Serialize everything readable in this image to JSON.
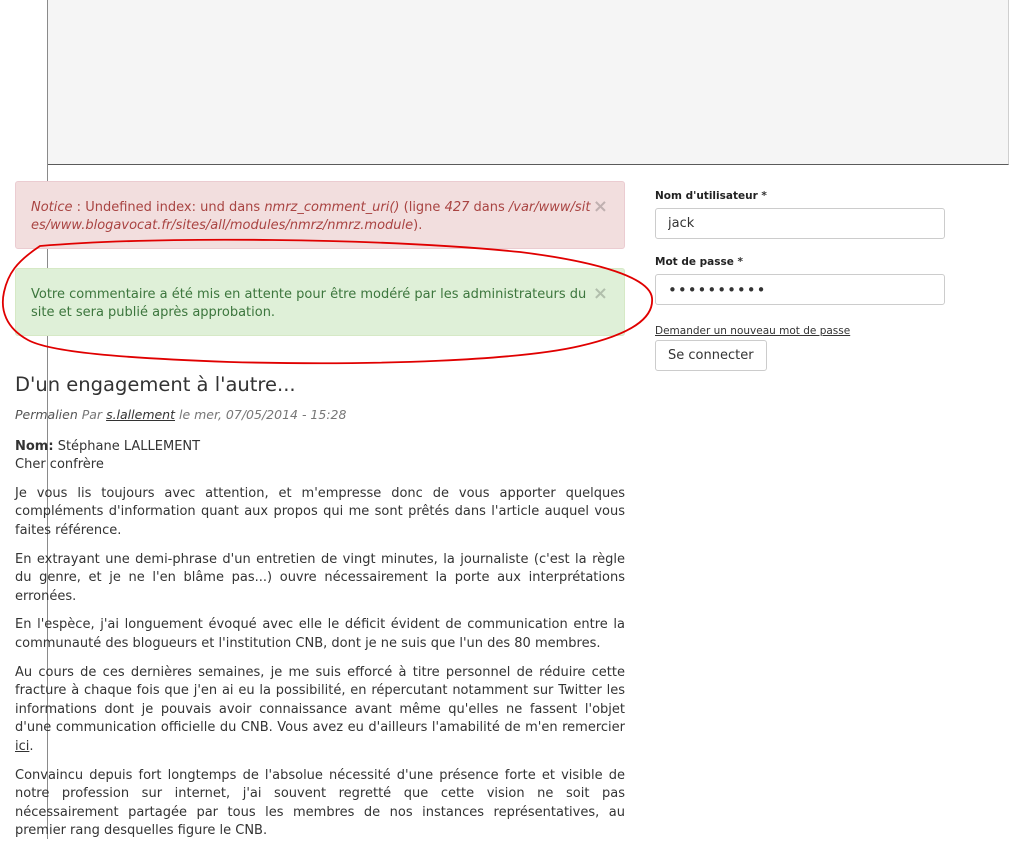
{
  "alerts": {
    "notice": {
      "prefix": "Notice",
      "sep": " : Undefined index: und dans ",
      "func": "nmrz_comment_uri()",
      "line_open": " (ligne ",
      "line": "427",
      "line_in": " dans ",
      "path": "/var/www/sites/www.blogavocat.fr/sites/all/modules/nmrz/nmrz.module",
      "end": ").",
      "close": "×"
    },
    "success": {
      "text": "Votre commentaire a été mis en attente pour être modéré par les administrateurs du site et sera publié après approbation.",
      "close": "×"
    }
  },
  "article": {
    "title": "D'un engagement à l'autre...",
    "meta": {
      "permalink": "Permalien",
      "by": " Par ",
      "author": "s.lallement",
      "date": " le mer, 07/05/2014 - 15:28"
    },
    "name_label": "Nom:",
    "name_value": " Stéphane LALLEMENT",
    "greeting": "Cher confrère",
    "paragraphs": [
      "Je vous lis toujours avec attention, et m'empresse donc de vous apporter quelques compléments d'information quant aux propos qui me sont prêtés dans l'article auquel vous faites référence.",
      "En extrayant une demi-phrase d'un entretien de vingt minutes, la journaliste (c'est la règle du genre, et je ne l'en blâme pas...) ouvre nécessairement la porte aux interprétations erronées.",
      "En l'espèce, j'ai longuement évoqué avec elle le déficit évident de communication entre la communauté des blogueurs et l'institution CNB, dont je ne suis que l'un des 80 membres."
    ],
    "p4_text": "Au cours de ces dernières semaines, je me suis efforcé à titre personnel de réduire cette fracture à chaque fois que j'en ai eu la possibilité, en répercutant notamment sur Twitter les informations dont je pouvais avoir connaissance avant même qu'elles ne fassent l'objet d'une communication officielle du CNB. Vous avez eu d'ailleurs l'amabilité de m'en remercier ",
    "p4_link": "ici",
    "p4_end": ".",
    "p5": "Convaincu depuis fort longtemps de l'absolue nécessité d'une présence forte et visible de notre profession sur internet, j'ai souvent regretté que cette vision ne soit pas nécessairement partagée par tous les membres de nos instances représentatives, au premier rang desquelles figure le CNB."
  },
  "login": {
    "username_label": "Nom d'utilisateur",
    "required_mark": "*",
    "username_value": "jack",
    "password_label": "Mot de passe",
    "password_value": "••••••••••",
    "forgot_link": "Demander un nouveau mot de passe",
    "submit_label": "Se connecter"
  },
  "colors": {
    "danger_bg": "#f2dede",
    "danger_text": "#a94442",
    "success_bg": "#dff0d8",
    "success_text": "#3c763d",
    "annotation": "#e00000"
  }
}
